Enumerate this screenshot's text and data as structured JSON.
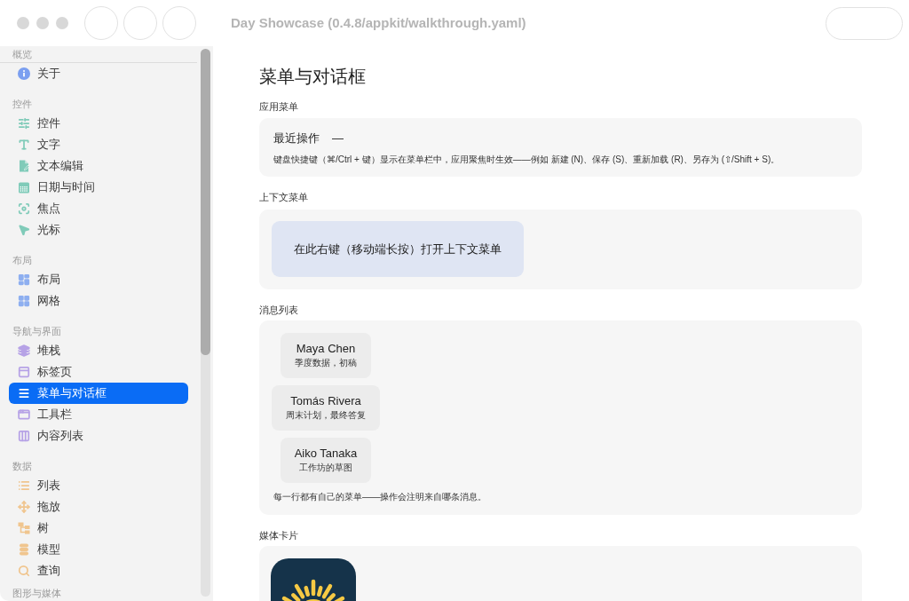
{
  "window": {
    "title": "Day Showcase (0.4.8/appkit/walkthrough.yaml)"
  },
  "sidebar": {
    "sections": [
      {
        "header": "概览",
        "color": "#7b9ff0",
        "items": [
          {
            "label": "关于",
            "selected": false
          }
        ]
      },
      {
        "header": "控件",
        "color": "#80cbb9",
        "items": [
          {
            "label": "控件",
            "selected": false
          },
          {
            "label": "文字",
            "selected": false
          },
          {
            "label": "文本编辑",
            "selected": false
          },
          {
            "label": "日期与时间",
            "selected": false
          },
          {
            "label": "焦点",
            "selected": false
          },
          {
            "label": "光标",
            "selected": false
          }
        ]
      },
      {
        "header": "布局",
        "color": "#8eaff0",
        "items": [
          {
            "label": "布局",
            "selected": false
          },
          {
            "label": "网格",
            "selected": false
          }
        ]
      },
      {
        "header": "导航与界面",
        "color": "#b6a2e6",
        "items": [
          {
            "label": "堆栈",
            "selected": false
          },
          {
            "label": "标签页",
            "selected": false
          },
          {
            "label": "菜单与对话框",
            "selected": true
          },
          {
            "label": "工具栏",
            "selected": false
          },
          {
            "label": "内容列表",
            "selected": false
          }
        ]
      },
      {
        "header": "数据",
        "color": "#f0c58e",
        "items": [
          {
            "label": "列表",
            "selected": false
          },
          {
            "label": "拖放",
            "selected": false
          },
          {
            "label": "树",
            "selected": false
          },
          {
            "label": "模型",
            "selected": false
          },
          {
            "label": "查询",
            "selected": false
          }
        ]
      },
      {
        "header": "图形与媒体"
      }
    ]
  },
  "page": {
    "title": "菜单与对话框",
    "sections": [
      {
        "kind": "app_menu",
        "label": "应用菜单",
        "recent_label": "最近操作",
        "recent_value": "—",
        "note": "键盘快捷键（⌘/Ctrl + 键）显示在菜单栏中，应用聚焦时生效——例如 新建 (N)、保存 (S)、重新加载 (R)、另存为 (⇧/Shift + S)。"
      },
      {
        "kind": "context_menu",
        "label": "上下文菜单",
        "target": "在此右键（移动端长按）打开上下文菜单"
      },
      {
        "kind": "message_list",
        "label": "消息列表",
        "messages": [
          {
            "sender": "Maya Chen",
            "subject": "季度数据，初稿"
          },
          {
            "sender": "Tomás Rivera",
            "subject": "周末计划，最终答复"
          },
          {
            "sender": "Aiko Tanaka",
            "subject": "工作坊的草图"
          }
        ],
        "note": "每一行都有自己的菜单——操作会注明来自哪条消息。"
      },
      {
        "kind": "media_card",
        "label": "媒体卡片"
      }
    ]
  }
}
